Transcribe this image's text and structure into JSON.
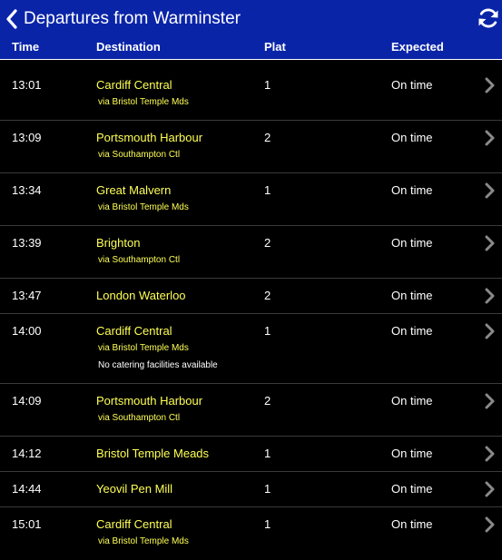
{
  "header": {
    "title": "Departures from Warminster",
    "back_icon": "chevron-left-icon",
    "refresh_icon": "refresh-icon",
    "background": "#0a24a8"
  },
  "columns": {
    "time": "Time",
    "destination": "Destination",
    "platform": "Plat",
    "expected": "Expected"
  },
  "colors": {
    "destination": "#ffff55",
    "divider": "#3a3a3a"
  },
  "departures": [
    {
      "time": "13:01",
      "destination": "Cardiff Central",
      "via": "via Bristol Temple Mds",
      "note": "",
      "platform": "1",
      "expected": "On time"
    },
    {
      "time": "13:09",
      "destination": "Portsmouth Harbour",
      "via": "via Southampton Ctl",
      "note": "",
      "platform": "2",
      "expected": "On time"
    },
    {
      "time": "13:34",
      "destination": "Great Malvern",
      "via": "via Bristol Temple Mds",
      "note": "",
      "platform": "1",
      "expected": "On time"
    },
    {
      "time": "13:39",
      "destination": "Brighton",
      "via": "via Southampton Ctl",
      "note": "",
      "platform": "2",
      "expected": "On time"
    },
    {
      "time": "13:47",
      "destination": "London Waterloo",
      "via": "",
      "note": "",
      "platform": "2",
      "expected": "On time"
    },
    {
      "time": "14:00",
      "destination": "Cardiff Central",
      "via": "via Bristol Temple Mds",
      "note": "No catering facilities available",
      "platform": "1",
      "expected": "On time"
    },
    {
      "time": "14:09",
      "destination": "Portsmouth Harbour",
      "via": "via Southampton Ctl",
      "note": "",
      "platform": "2",
      "expected": "On time"
    },
    {
      "time": "14:12",
      "destination": "Bristol Temple Meads",
      "via": "",
      "note": "",
      "platform": "1",
      "expected": "On time"
    },
    {
      "time": "14:44",
      "destination": "Yeovil Pen Mill",
      "via": "",
      "note": "",
      "platform": "1",
      "expected": "On time"
    },
    {
      "time": "15:01",
      "destination": "Cardiff Central",
      "via": "via Bristol Temple Mds",
      "note": "",
      "platform": "1",
      "expected": "On time"
    }
  ]
}
